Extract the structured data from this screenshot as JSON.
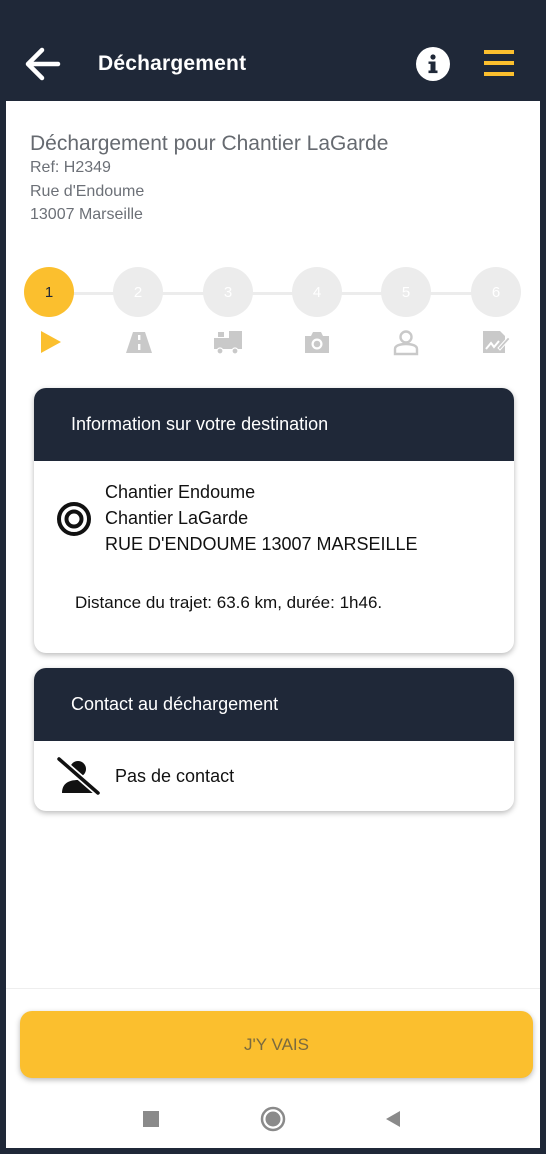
{
  "appbar": {
    "title": "Déchargement",
    "icons": {
      "back": "arrow-left-icon",
      "info": "info-icon",
      "menu": "hamburger-menu-icon"
    }
  },
  "job": {
    "title": "Déchargement pour Chantier LaGarde",
    "ref": "Ref: H2349",
    "street": "Rue d'Endoume",
    "city": "13007 Marseille"
  },
  "stepper": {
    "active_step": 1,
    "steps": [
      {
        "label": "1",
        "icon": "play-icon"
      },
      {
        "label": "2",
        "icon": "road-icon"
      },
      {
        "label": "3",
        "icon": "unloading-truck-icon"
      },
      {
        "label": "4",
        "icon": "camera-icon"
      },
      {
        "label": "5",
        "icon": "person-icon"
      },
      {
        "label": "6",
        "icon": "signature-icon"
      }
    ]
  },
  "destination_card": {
    "header": "Information sur votre destination",
    "name": "Chantier Endoume",
    "site": "Chantier LaGarde",
    "address": "RUE D'ENDOUME 13007 MARSEILLE",
    "distance_text": "Distance du trajet: 63.6 km, durée: 1h46."
  },
  "contact_card": {
    "header": "Contact au déchargement",
    "status": "Pas de contact"
  },
  "actions": {
    "go_label": "J'Y VAIS"
  },
  "colors": {
    "navy": "#1f2838",
    "accent_yellow": "#fbbf2e",
    "inactive_step": "#ececec",
    "inactive_icon": "#c9c9c9"
  }
}
